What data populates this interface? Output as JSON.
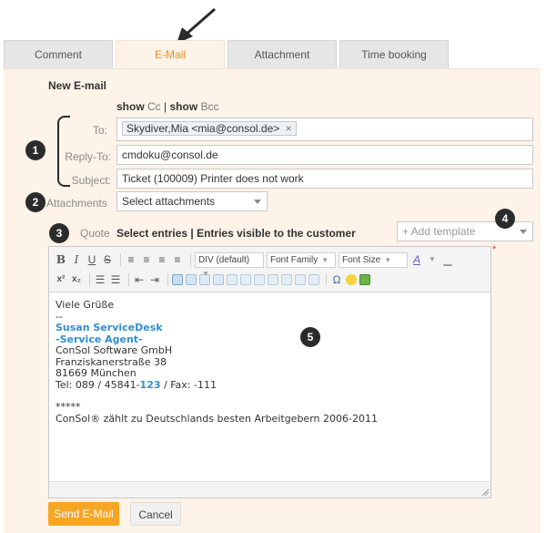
{
  "tabs": [
    {
      "label": "Comment"
    },
    {
      "label": "E-Mail"
    },
    {
      "label": "Attachment"
    },
    {
      "label": "Time booking"
    }
  ],
  "form": {
    "section_title": "New E-mail",
    "show_cc": "show",
    "cc_label": "Cc",
    "separator": "|",
    "show_bcc": "show",
    "bcc_label": "Bcc",
    "to_label": "To:",
    "to_token": "Skydiver,Mia <mia@consol.de>",
    "token_remove": "×",
    "reply_to_label": "Reply-To:",
    "reply_to_value": "cmdoku@consol.de",
    "subject_label": "Subject:",
    "subject_value": "Ticket (100009) Printer does not work",
    "attachments_label": "Attachments",
    "attachments_placeholder": "Select attachments",
    "quote_label": "Quote",
    "quote_select_entries": "Select entries",
    "quote_visible_entries": "Entries visible to the customer",
    "template_placeholder": "+ Add template",
    "required_marker": "*"
  },
  "editor": {
    "format_select": "DIV (default)",
    "font_family_select": "Font Family",
    "font_size_select": "Font Size",
    "body_lines": [
      "Viele Grüße",
      "--",
      "Susan ServiceDesk",
      "-Service Agent-",
      "ConSol Software GmbH",
      "Franziskanerstraße 38",
      "81669 München",
      "Tel: 089 / 45841-",
      "123",
      " / Fax: -111",
      "*****",
      "ConSol® zählt zu Deutschlands besten Arbeitgebern 2006-2011"
    ]
  },
  "badges": [
    "1",
    "2",
    "3",
    "4",
    "5"
  ],
  "buttons": {
    "send": "Send E-Mail",
    "cancel": "Cancel"
  },
  "colors": {
    "accent": "#f08c1e",
    "panel_bg": "#fdf3e8",
    "link_blue": "#2f8fcf",
    "badge": "#2b2b2b",
    "send_button": "#f5a623"
  }
}
